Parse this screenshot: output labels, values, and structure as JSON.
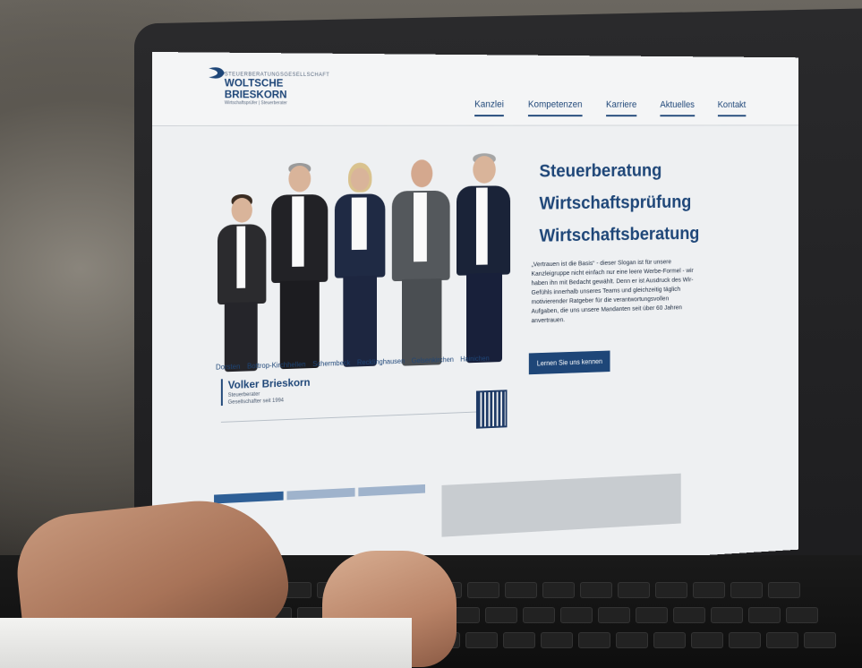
{
  "site": {
    "logo": {
      "top": "STEUERBERATUNGSGESELLSCHAFT",
      "line1": "WOLTSCHE",
      "line2": "BRIESKORN",
      "sub": "Wirtschaftsprüfer | Steuerberater"
    },
    "nav": [
      "Kanzlei",
      "Kompetenzen",
      "Karriere",
      "Aktuelles",
      "Kontakt"
    ]
  },
  "hero": {
    "headline": [
      "Steuerberatung",
      "Wirtschaftsprüfung",
      "Wirtschaftsberatung"
    ],
    "intro": "„Vertrauen ist die Basis“ - dieser Slogan ist für unsere Kanzleigruppe nicht einfach nur eine leere Werbe-Formel - wir haben ihn mit Bedacht gewählt. Denn er ist Ausdruck des Wir-Gefühls innerhalb unseres Teams und gleichzeitig täglich motivierender Ratgeber für die verantwortungsvollen Aufgaben, die uns unsere Mandanten seit über 60 Jahren anvertrauen.",
    "cta": "Lernen Sie uns kennen"
  },
  "locations": [
    "Dorsten",
    "Bottrop-Kirchhellen",
    "Schermbeck",
    "Recklinghausen",
    "Gelsenkirchen",
    "Hainichen"
  ],
  "person": {
    "name": "Volker Brieskorn",
    "role": "Steuerberater",
    "since": "Gesellschafter seit 1994"
  },
  "colors": {
    "brand": "#1e4678"
  }
}
